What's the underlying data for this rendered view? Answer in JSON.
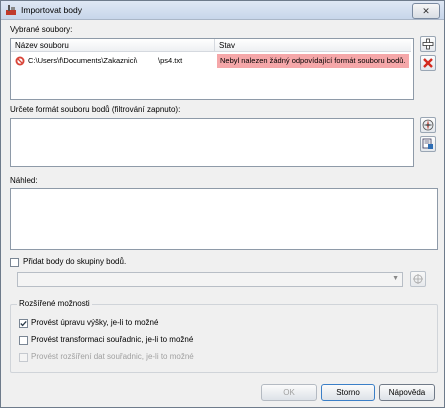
{
  "window": {
    "title": "Importovat body",
    "close_glyph": "✕"
  },
  "selected_files": {
    "label": "Vybrané soubory:",
    "columns": [
      "Název souboru",
      "Stav"
    ],
    "rows": [
      {
        "file": "C:\\Users\\f\\Documents\\Zakaznici\\          \\ps4.txt",
        "status": "Nebyl nalezen žádný odpovídající formát souboru bodů."
      }
    ],
    "add_icon": "plus-icon",
    "remove_icon": "red-x-icon",
    "error_color": "#f5a7a9"
  },
  "format": {
    "label": "Určete formát souboru bodů (filtrování zapnuto):"
  },
  "preview": {
    "label": "Náhled:"
  },
  "point_group": {
    "checkbox_label": "Přidat body do skupiny bodů.",
    "checked": false,
    "selected_value": ""
  },
  "advanced": {
    "label": "Rozšířené možnosti",
    "options": [
      {
        "label": "Provést úpravu výšky, je-li to možné",
        "checked": true,
        "enabled": true
      },
      {
        "label": "Provést transformaci souřadnic, je-li to možné",
        "checked": false,
        "enabled": true
      },
      {
        "label": "Provést rozšíření dat souřadnic, je-li to možné",
        "checked": false,
        "enabled": false
      }
    ]
  },
  "buttons": {
    "ok": "OK",
    "cancel": "Storno",
    "help": "Nápověda"
  }
}
